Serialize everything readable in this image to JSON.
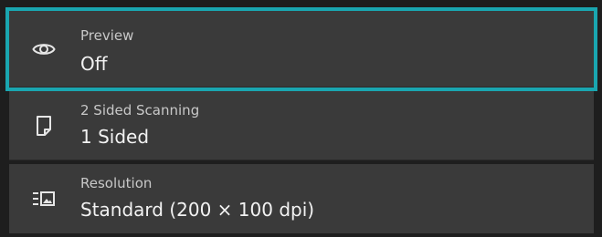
{
  "settings": {
    "items": [
      {
        "label": "Preview",
        "value": "Off",
        "icon": "eye-icon",
        "selected": true
      },
      {
        "label": "2 Sided Scanning",
        "value": "1 Sided",
        "icon": "page-icon",
        "selected": false
      },
      {
        "label": "Resolution",
        "value": "Standard (200 × 100 dpi)",
        "icon": "resolution-icon",
        "selected": false
      }
    ]
  },
  "colors": {
    "selection_outline": "#1aa6b0",
    "row_background": "#3a3a3a",
    "page_background": "#1e1e1e",
    "label_text": "#c8c8c8",
    "value_text": "#f2f2f2"
  }
}
